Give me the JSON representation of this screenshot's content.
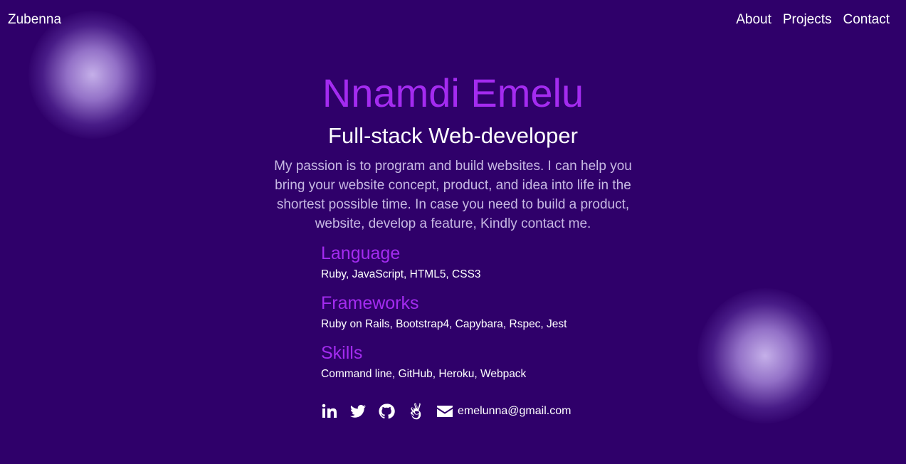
{
  "nav": {
    "brand": "Zubenna",
    "links": [
      "About",
      "Projects",
      "Contact"
    ]
  },
  "hero": {
    "name": "Nnamdi Emelu",
    "role": "Full-stack Web-developer",
    "bio": "My passion is to program and build websites. I can help you bring your website concept, product, and idea into life in the shortest possible time. In case you need to build a product, website, develop a feature, Kindly contact me."
  },
  "skills": [
    {
      "title": "Language",
      "list": "Ruby, JavaScript, HTML5, CSS3"
    },
    {
      "title": "Frameworks",
      "list": "Ruby on Rails, Bootstrap4, Capybara, Rspec, Jest"
    },
    {
      "title": "Skills",
      "list": "Command line, GitHub, Heroku, Webpack"
    }
  ],
  "social": {
    "icons": [
      "linkedin-icon",
      "twitter-icon",
      "github-icon",
      "angellist-icon",
      "envelope-icon"
    ],
    "email": "emelunna@gmail.com"
  },
  "colors": {
    "background": "#2f006a",
    "accent": "#a42bf0",
    "bio_text": "#c7b8e3"
  }
}
